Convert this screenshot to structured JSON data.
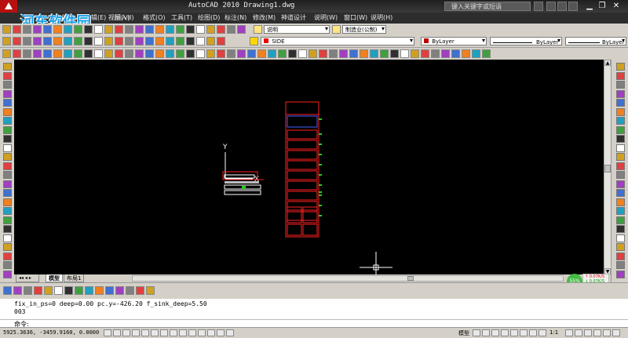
{
  "titlebar": {
    "title": "AutoCAD 2010  Drawing1.dwg",
    "search_placeholder": "键入关键字或短语"
  },
  "watermark": {
    "text": "河东软件园"
  },
  "menu": {
    "items": [
      "文件(F)",
      "编辑(E)",
      "视图(V)",
      "插入(I)",
      "格式(O)",
      "工具(T)",
      "绘图(D)",
      "标注(N)",
      "修改(M)",
      "神道设计",
      "说明(W)",
      "窗口(W)",
      "说明(H)"
    ]
  },
  "toolbars": {
    "textstyle_value": "说明",
    "dimstyle_value": "制造业(公制)",
    "layer_value": "SIDE",
    "color_value": "ByLayer",
    "linetype_value": "ByLayer",
    "lineweight_value": "ByLayer",
    "row2_tools": [
      "改",
      "删",
      "汇",
      "剪",
      "设",
      "前"
    ],
    "bottom_tools": [
      "改",
      "删",
      "汇",
      "设",
      "前"
    ]
  },
  "canvas": {
    "ucs_y": "Y",
    "ucs_x": "X"
  },
  "tabs": {
    "model": "模型",
    "layout1": "布局1"
  },
  "network": {
    "percent": "55%",
    "up": "0.07K/S",
    "down": "0.07K/S"
  },
  "command": {
    "history": [
      "fix_in_ps=0 deep=0.00 pc.y=-426.20 f_sink_deep=5.50",
      "003"
    ],
    "prompt": "命令:"
  },
  "status": {
    "coords": "5925.3636,  -3459.9160, 0.0000",
    "model_label": "模型",
    "scale_label": "1:1"
  },
  "colors": {
    "canvas_bg": "#000000",
    "drawing_red": "#ff2020",
    "accent_green": "#22cc22",
    "crosshair": "#ffffff"
  }
}
